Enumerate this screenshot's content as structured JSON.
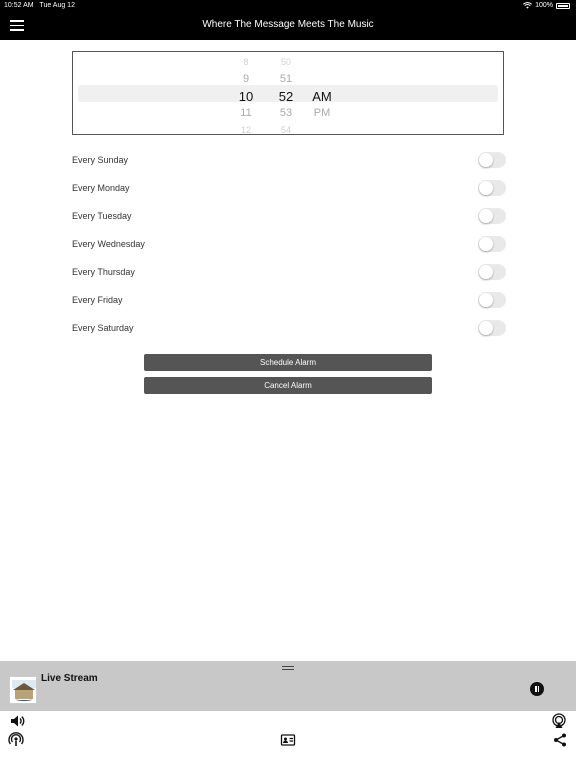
{
  "status_bar": {
    "time": "10:52 AM",
    "date": "Tue Aug 12",
    "battery": "100%"
  },
  "nav": {
    "title": "Where The Message Meets The Music",
    "menu_icon": "hamburger-icon"
  },
  "time_picker": {
    "hours": [
      "8",
      "9",
      "10",
      "11",
      "12"
    ],
    "minutes": [
      "50",
      "51",
      "52",
      "53",
      "54"
    ],
    "ampm": [
      "AM",
      "PM"
    ],
    "selected": {
      "hour": "10",
      "minute": "52",
      "ampm": "AM"
    }
  },
  "days": [
    {
      "label": "Every Sunday",
      "on": false
    },
    {
      "label": "Every Monday",
      "on": false
    },
    {
      "label": "Every Tuesday",
      "on": false
    },
    {
      "label": "Every Wednesday",
      "on": false
    },
    {
      "label": "Every Thursday",
      "on": false
    },
    {
      "label": "Every Friday",
      "on": false
    },
    {
      "label": "Every Saturday",
      "on": false
    }
  ],
  "buttons": {
    "schedule": "Schedule Alarm",
    "cancel": "Cancel Alarm"
  },
  "player": {
    "title": "Live Stream",
    "state": "playing"
  },
  "toolbar_icons": [
    "volume-icon",
    "airplay-icon",
    "podcast-icon",
    "contact-card-icon",
    "share-icon"
  ],
  "colors": {
    "bar": "#000000",
    "button": "#555555",
    "player_bg": "#c8c8c8"
  }
}
